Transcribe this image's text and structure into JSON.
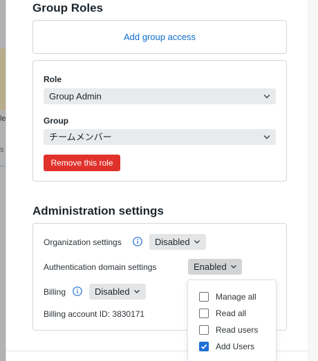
{
  "background": {
    "fragment_1": "le",
    "fragment_2": "s"
  },
  "group_roles": {
    "title": "Group Roles",
    "add_access_label": "Add group access",
    "role_label": "Role",
    "role_value": "Group Admin",
    "group_label": "Group",
    "group_value": "チームメンバー",
    "remove_label": "Remove this role"
  },
  "admin": {
    "title": "Administration settings",
    "org_label": "Organization settings",
    "org_value": "Disabled",
    "auth_label": "Authentication domain settings",
    "auth_value": "Enabled",
    "billing_label": "Billing",
    "billing_value": "Disabled",
    "billing_account_label": "Billing account ID:",
    "billing_account_value": "3830171"
  },
  "auth_dropdown": {
    "options": [
      {
        "label": "Manage all",
        "checked": false
      },
      {
        "label": "Read all",
        "checked": false
      },
      {
        "label": "Read users",
        "checked": false
      },
      {
        "label": "Add Users",
        "checked": true
      }
    ]
  },
  "colors": {
    "link": "#0b6bcb",
    "danger": "#e0312a",
    "info_icon": "#1d6fd6",
    "checkbox_checked": "#1d6fd6"
  },
  "icons": {
    "info": "info-circle-icon",
    "chevron": "chevron-down-icon",
    "check": "check-icon"
  }
}
